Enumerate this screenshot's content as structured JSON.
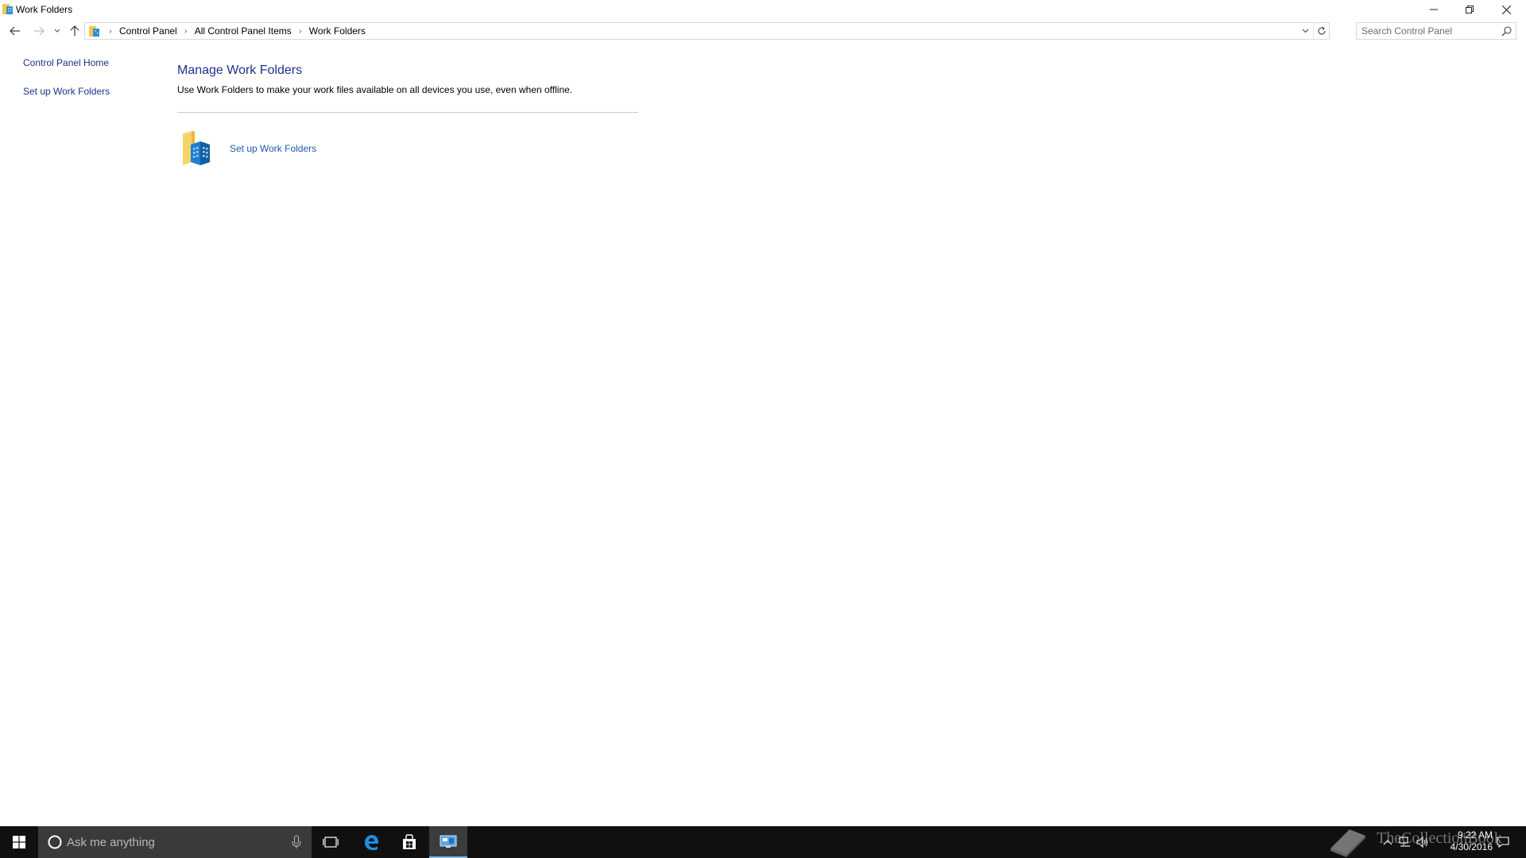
{
  "window": {
    "title": "Work Folders",
    "controls": {
      "minimize": "minimize",
      "maximize": "restore",
      "close": "close"
    }
  },
  "address": {
    "crumbs": [
      "Control Panel",
      "All Control Panel Items",
      "Work Folders"
    ]
  },
  "search": {
    "placeholder": "Search Control Panel"
  },
  "sidebar": {
    "links": [
      {
        "label": "Control Panel Home"
      },
      {
        "label": "Set up Work Folders"
      }
    ]
  },
  "main": {
    "title": "Manage Work Folders",
    "description": "Use Work Folders to make your work files available on all devices you use, even when offline.",
    "task_label": "Set up Work Folders"
  },
  "taskbar": {
    "search_placeholder": "Ask me anything",
    "time": "9:22 AM",
    "date": "4/30/2016",
    "watermark": "TheCollectionBook"
  },
  "colors": {
    "link": "#1e3287",
    "taskbar": "#101010",
    "cortana_box": "#3a3a3a",
    "active_indicator": "#76b9ed"
  }
}
